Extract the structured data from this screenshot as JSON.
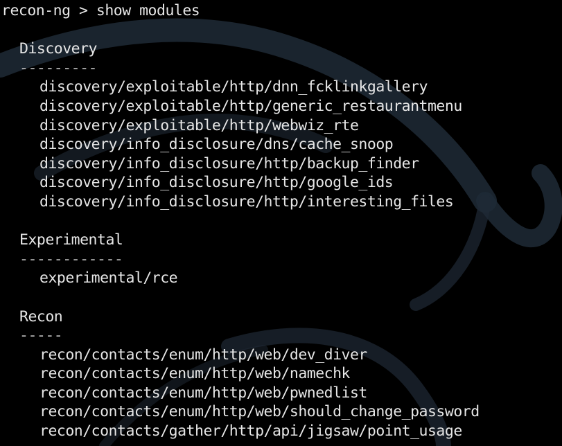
{
  "terminal": {
    "prompt": "recon-ng > ",
    "command": "show modules",
    "colors": {
      "background": "#000000",
      "text": "#e6e6e6",
      "watermark": "#1f2a36"
    }
  },
  "sections": [
    {
      "heading": "Discovery",
      "rule": "---------",
      "modules": [
        "discovery/exploitable/http/dnn_fcklinkgallery",
        "discovery/exploitable/http/generic_restaurantmenu",
        "discovery/exploitable/http/webwiz_rte",
        "discovery/info_disclosure/dns/cache_snoop",
        "discovery/info_disclosure/http/backup_finder",
        "discovery/info_disclosure/http/google_ids",
        "discovery/info_disclosure/http/interesting_files"
      ]
    },
    {
      "heading": "Experimental",
      "rule": "------------",
      "modules": [
        "experimental/rce"
      ]
    },
    {
      "heading": "Recon",
      "rule": "-----",
      "modules": [
        "recon/contacts/enum/http/web/dev_diver",
        "recon/contacts/enum/http/web/namechk",
        "recon/contacts/enum/http/web/pwnedlist",
        "recon/contacts/enum/http/web/should_change_password",
        "recon/contacts/gather/http/api/jigsaw/point_usage"
      ]
    }
  ]
}
